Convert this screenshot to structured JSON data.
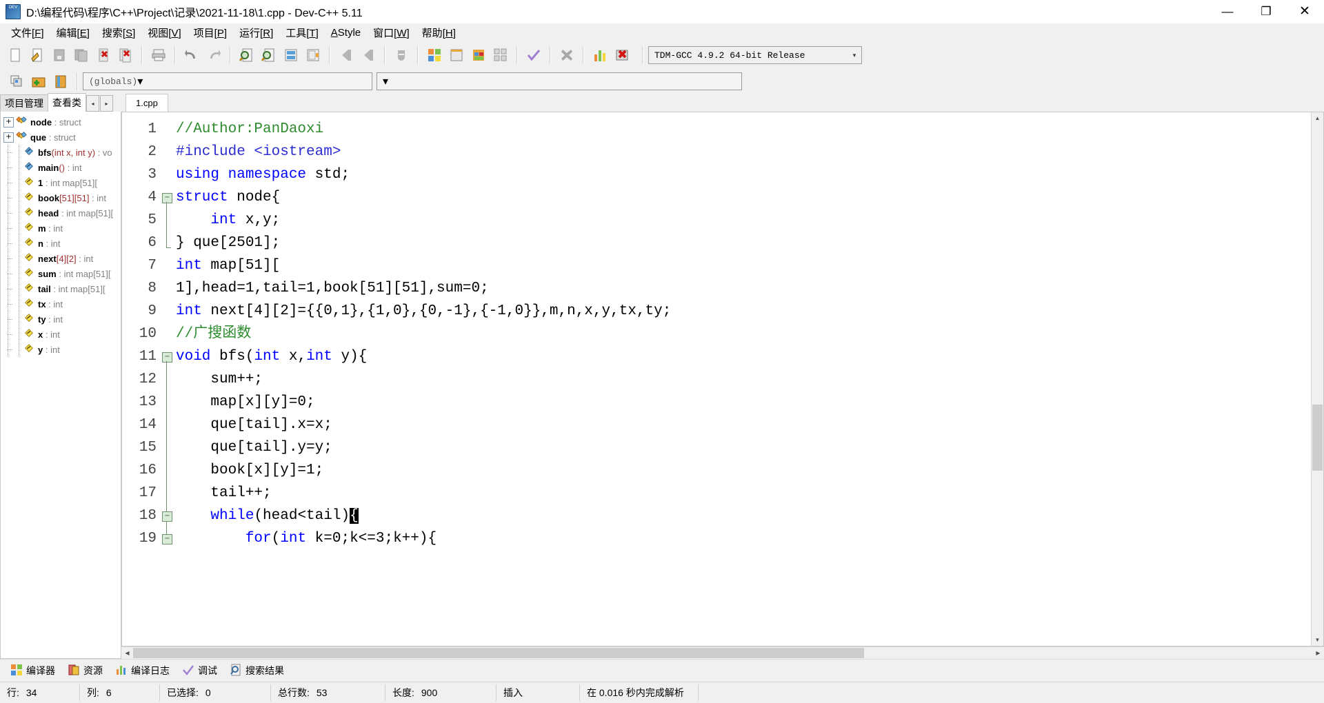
{
  "window": {
    "title": "D:\\编程代码\\程序\\C++\\Project\\记录\\2021-11-18\\1.cpp - Dev-C++ 5.11",
    "icon": "dev-cpp-icon",
    "minimize": "—",
    "maximize": "❐",
    "close": "✕"
  },
  "menu": [
    {
      "label": "文件",
      "accel": "F"
    },
    {
      "label": "编辑",
      "accel": "E"
    },
    {
      "label": "搜索",
      "accel": "S"
    },
    {
      "label": "视图",
      "accel": "V"
    },
    {
      "label": "项目",
      "accel": "P"
    },
    {
      "label": "运行",
      "accel": "R"
    },
    {
      "label": "工具",
      "accel": "T"
    },
    {
      "label": "AStyle",
      "accel": "A"
    },
    {
      "label": "窗口",
      "accel": "W"
    },
    {
      "label": "帮助",
      "accel": "H"
    }
  ],
  "toolbar": {
    "icons": [
      "new-file-icon",
      "open-file-icon",
      "save-icon",
      "save-all-icon",
      "close-file-icon",
      "close-all-icon",
      "print-icon",
      "undo-icon",
      "redo-icon",
      "find-icon",
      "replace-icon",
      "goto-line-icon",
      "goto-function-icon",
      "back-icon",
      "forward-icon",
      "toggle-icon",
      "compile-icon",
      "run-icon",
      "compile-run-icon",
      "rebuild-icon",
      "syntax-check-icon",
      "stop-execution-icon",
      "profile-icon",
      "debug-icon"
    ],
    "compiler_set": "TDM-GCC 4.9.2 64-bit Release",
    "compiler_arrow": "▾"
  },
  "toolbar2": {
    "icons": [
      "add-to-project-icon",
      "new-class-icon",
      "new-member-icon"
    ],
    "scope_combo": "(globals)",
    "member_combo": "",
    "arrow": "▾"
  },
  "sidebar": {
    "tabs": [
      {
        "label": "项目管理",
        "active": false
      },
      {
        "label": "查看类",
        "active": true
      }
    ],
    "nav_prev": "◂",
    "nav_next": "▸",
    "tree": [
      {
        "name": "node",
        "sep": ":",
        "type": "struct",
        "args": "",
        "icon": "struct-icon",
        "expander": "+",
        "depth": 0
      },
      {
        "name": "que",
        "sep": ":",
        "type": "struct",
        "args": "",
        "icon": "struct-icon",
        "expander": "+",
        "depth": 0
      },
      {
        "name": "bfs",
        "sep": ":",
        "type": "vo",
        "args": "(int x, int y)",
        "icon": "method-icon",
        "expander": "",
        "depth": 1
      },
      {
        "name": "main",
        "sep": ":",
        "type": "int",
        "args": "()",
        "icon": "method-icon",
        "expander": "",
        "depth": 1
      },
      {
        "name": "1",
        "sep": ":",
        "type": "int map[51][",
        "args": "",
        "icon": "variable-icon",
        "expander": "",
        "depth": 1
      },
      {
        "name": "book",
        "sep": ":",
        "type": "int",
        "args": "[51][51]",
        "icon": "variable-icon",
        "expander": "",
        "depth": 1
      },
      {
        "name": "head",
        "sep": ":",
        "type": "int map[51][",
        "args": "",
        "icon": "variable-icon",
        "expander": "",
        "depth": 1
      },
      {
        "name": "m",
        "sep": ":",
        "type": "int",
        "args": "",
        "icon": "variable-icon",
        "expander": "",
        "depth": 1
      },
      {
        "name": "n",
        "sep": ":",
        "type": "int",
        "args": "",
        "icon": "variable-icon",
        "expander": "",
        "depth": 1
      },
      {
        "name": "next",
        "sep": ":",
        "type": "int",
        "args": "[4][2]",
        "icon": "variable-icon",
        "expander": "",
        "depth": 1
      },
      {
        "name": "sum",
        "sep": ":",
        "type": "int map[51][",
        "args": "",
        "icon": "variable-icon",
        "expander": "",
        "depth": 1
      },
      {
        "name": "tail",
        "sep": ":",
        "type": "int map[51][",
        "args": "",
        "icon": "variable-icon",
        "expander": "",
        "depth": 1
      },
      {
        "name": "tx",
        "sep": ":",
        "type": "int",
        "args": "",
        "icon": "variable-icon",
        "expander": "",
        "depth": 1
      },
      {
        "name": "ty",
        "sep": ":",
        "type": "int",
        "args": "",
        "icon": "variable-icon",
        "expander": "",
        "depth": 1
      },
      {
        "name": "x",
        "sep": ":",
        "type": "int",
        "args": "",
        "icon": "variable-icon",
        "expander": "",
        "depth": 1
      },
      {
        "name": "y",
        "sep": ":",
        "type": "int",
        "args": "",
        "icon": "variable-icon",
        "expander": "",
        "depth": 1
      }
    ]
  },
  "editor": {
    "tab": "1.cpp",
    "first_line": 1,
    "lines": [
      {
        "n": "1",
        "fold": "",
        "tokens": [
          {
            "t": "//Author:PanDaoxi",
            "c": "cm"
          }
        ]
      },
      {
        "n": "2",
        "fold": "",
        "tokens": [
          {
            "t": "#include <iostream>",
            "c": "pp"
          }
        ]
      },
      {
        "n": "3",
        "fold": "",
        "tokens": [
          {
            "t": "using namespace",
            "c": "kw"
          },
          {
            "t": " std;",
            "c": ""
          }
        ]
      },
      {
        "n": "4",
        "fold": "open",
        "tokens": [
          {
            "t": "struct",
            "c": "kw"
          },
          {
            "t": " node{",
            "c": ""
          }
        ]
      },
      {
        "n": "5",
        "fold": "bar",
        "tokens": [
          {
            "t": "    ",
            "c": ""
          },
          {
            "t": "int",
            "c": "kw"
          },
          {
            "t": " x,y;",
            "c": ""
          }
        ]
      },
      {
        "n": "6",
        "fold": "end",
        "tokens": [
          {
            "t": "} que[2501];",
            "c": ""
          }
        ]
      },
      {
        "n": "7",
        "fold": "",
        "tokens": [
          {
            "t": "int",
            "c": "kw"
          },
          {
            "t": " map[51][",
            "c": ""
          }
        ]
      },
      {
        "n": "8",
        "fold": "",
        "tokens": [
          {
            "t": "1],head=1,tail=1,book[51][51],sum=0;",
            "c": ""
          }
        ]
      },
      {
        "n": "9",
        "fold": "",
        "tokens": [
          {
            "t": "int",
            "c": "kw"
          },
          {
            "t": " next[4][2]={{0,1},{1,0},{0,-1},{-1,0}},m,n,x,y,tx,ty;",
            "c": ""
          }
        ]
      },
      {
        "n": "10",
        "fold": "",
        "tokens": [
          {
            "t": "//广搜函数",
            "c": "cm"
          }
        ]
      },
      {
        "n": "11",
        "fold": "open",
        "tokens": [
          {
            "t": "void",
            "c": "kw"
          },
          {
            "t": " bfs(",
            "c": ""
          },
          {
            "t": "int",
            "c": "kw"
          },
          {
            "t": " x,",
            "c": ""
          },
          {
            "t": "int",
            "c": "kw"
          },
          {
            "t": " y){",
            "c": ""
          }
        ]
      },
      {
        "n": "12",
        "fold": "bar",
        "tokens": [
          {
            "t": "    sum++;",
            "c": ""
          }
        ]
      },
      {
        "n": "13",
        "fold": "bar",
        "tokens": [
          {
            "t": "    map[x][y]=0;",
            "c": ""
          }
        ]
      },
      {
        "n": "14",
        "fold": "bar",
        "tokens": [
          {
            "t": "    que[tail].x=x;",
            "c": ""
          }
        ]
      },
      {
        "n": "15",
        "fold": "bar",
        "tokens": [
          {
            "t": "    que[tail].y=y;",
            "c": ""
          }
        ]
      },
      {
        "n": "16",
        "fold": "bar",
        "tokens": [
          {
            "t": "    book[x][y]=1;",
            "c": ""
          }
        ]
      },
      {
        "n": "17",
        "fold": "bar",
        "tokens": [
          {
            "t": "    tail++;",
            "c": ""
          }
        ]
      },
      {
        "n": "18",
        "fold": "open2",
        "tokens": [
          {
            "t": "    ",
            "c": ""
          },
          {
            "t": "while",
            "c": "kw"
          },
          {
            "t": "(head<tail)",
            "c": ""
          },
          {
            "t": "{",
            "c": "sel"
          }
        ]
      },
      {
        "n": "19",
        "fold": "open2",
        "tokens": [
          {
            "t": "        ",
            "c": ""
          },
          {
            "t": "for",
            "c": "kw"
          },
          {
            "t": "(",
            "c": ""
          },
          {
            "t": "int",
            "c": "kw"
          },
          {
            "t": " k=0;k<=3;k++){",
            "c": ""
          }
        ]
      }
    ],
    "vscroll": {
      "up": "▲",
      "down": "▼"
    },
    "hscroll": {
      "left": "◀",
      "right": "▶"
    }
  },
  "bottom_tabs": [
    {
      "label": "编译器",
      "icon": "compiler-icon"
    },
    {
      "label": "资源",
      "icon": "resource-icon"
    },
    {
      "label": "编译日志",
      "icon": "compile-log-icon"
    },
    {
      "label": "调试",
      "icon": "debug-check-icon"
    },
    {
      "label": "搜索结果",
      "icon": "search-results-icon"
    }
  ],
  "statusbar": [
    {
      "label": "行:",
      "value": "34"
    },
    {
      "label": "列:",
      "value": "6"
    },
    {
      "label": "已选择:",
      "value": "0"
    },
    {
      "label": "总行数:",
      "value": "53"
    },
    {
      "label": "长度:",
      "value": "900"
    },
    {
      "label": "插入",
      "value": ""
    },
    {
      "label": "在 0.016 秒内完成解析",
      "value": ""
    }
  ]
}
